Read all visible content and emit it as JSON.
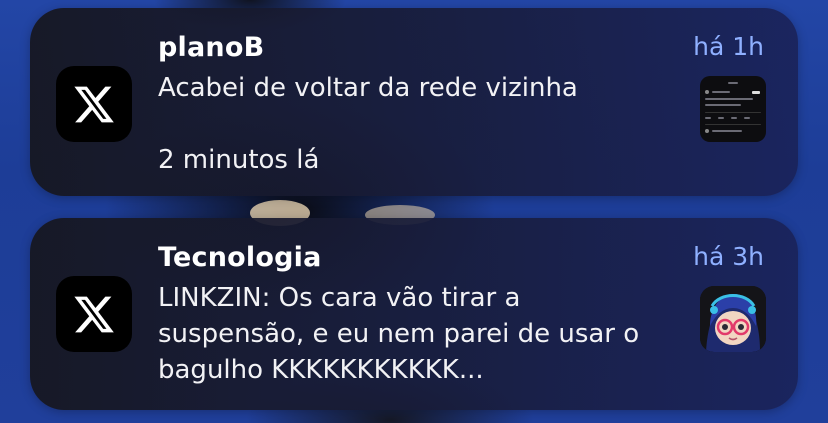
{
  "notifications": [
    {
      "title": "planoB",
      "time": "há 1h",
      "body_lines": [
        "Acabei de voltar da rede vizinha",
        "",
        "2 minutos lá"
      ],
      "app_icon": "x-logo-icon",
      "thumbnail": "post-screenshot-thumbnail"
    },
    {
      "title": "Tecnologia",
      "time": "há 3h",
      "body_lines": [
        "LINKZIN: Os cara vão tirar a",
        "suspensão, e eu nem parei de usar o",
        "bagulho KKKKKKKKKKK..."
      ],
      "app_icon": "x-logo-icon",
      "thumbnail": "avatar-thumbnail"
    }
  ],
  "colors": {
    "time_text": "#8fb0ff",
    "title_text": "#ffffff",
    "body_text": "#f2f2f5",
    "wallpaper_blue": "#1d3d97"
  }
}
